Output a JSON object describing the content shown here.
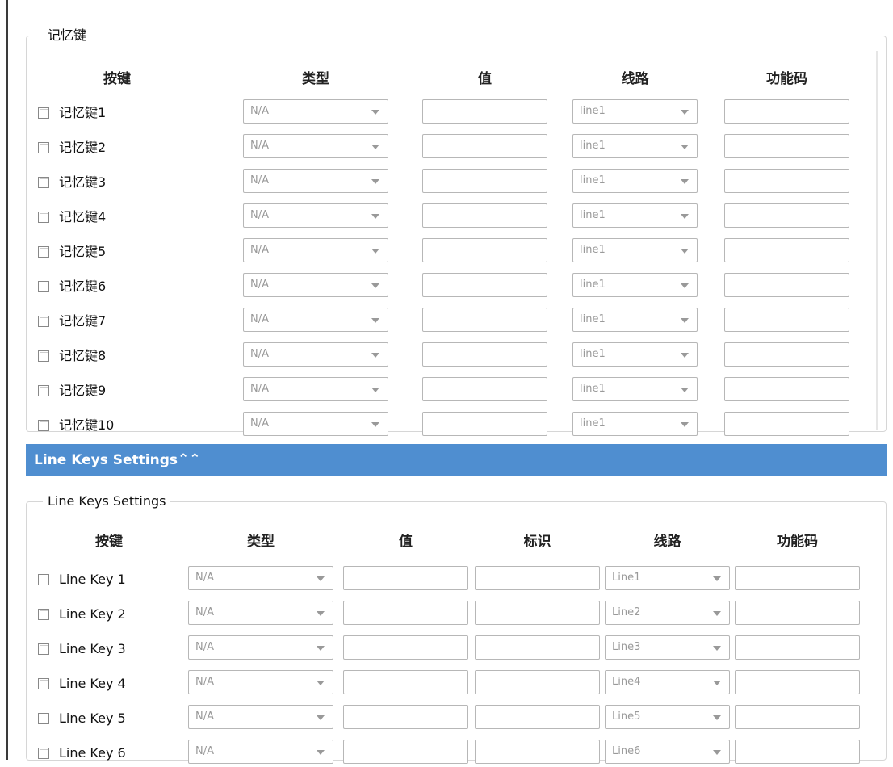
{
  "memory": {
    "legend": "记忆键",
    "headers": {
      "key": "按键",
      "type": "类型",
      "value": "值",
      "line": "线路",
      "code": "功能码"
    },
    "rows": [
      {
        "label": "记忆键1",
        "type": "N/A",
        "line": "line1"
      },
      {
        "label": "记忆键2",
        "type": "N/A",
        "line": "line1"
      },
      {
        "label": "记忆键3",
        "type": "N/A",
        "line": "line1"
      },
      {
        "label": "记忆键4",
        "type": "N/A",
        "line": "line1"
      },
      {
        "label": "记忆键5",
        "type": "N/A",
        "line": "line1"
      },
      {
        "label": "记忆键6",
        "type": "N/A",
        "line": "line1"
      },
      {
        "label": "记忆键7",
        "type": "N/A",
        "line": "line1"
      },
      {
        "label": "记忆键8",
        "type": "N/A",
        "line": "line1"
      },
      {
        "label": "记忆键9",
        "type": "N/A",
        "line": "line1"
      },
      {
        "label": "记忆键10",
        "type": "N/A",
        "line": "line1"
      }
    ]
  },
  "banner": {
    "title": "Line Keys Settings",
    "chevron": "⌃⌃",
    "color": "#4f8ed0"
  },
  "linekeys": {
    "legend": "Line Keys Settings",
    "headers": {
      "key": "按键",
      "type": "类型",
      "value": "值",
      "label": "标识",
      "line": "线路",
      "code": "功能码"
    },
    "rows": [
      {
        "label": "Line Key 1",
        "type": "N/A",
        "line": "Line1"
      },
      {
        "label": "Line Key 2",
        "type": "N/A",
        "line": "Line2"
      },
      {
        "label": "Line Key 3",
        "type": "N/A",
        "line": "Line3"
      },
      {
        "label": "Line Key 4",
        "type": "N/A",
        "line": "Line4"
      },
      {
        "label": "Line Key 5",
        "type": "N/A",
        "line": "Line5"
      },
      {
        "label": "Line Key 6",
        "type": "N/A",
        "line": "Line6"
      }
    ]
  }
}
